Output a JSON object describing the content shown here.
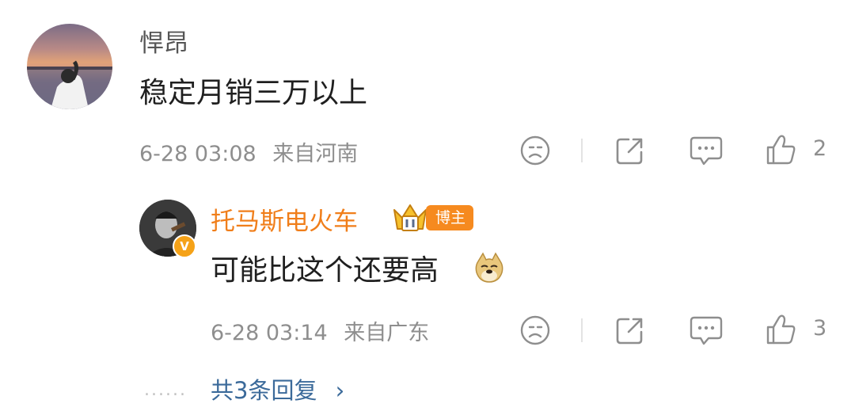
{
  "comment": {
    "username": "悍昂",
    "text": "稳定月销三万以上",
    "time": "6-28 03:08",
    "location": "来自河南",
    "like_count": "2"
  },
  "reply": {
    "username": "托马斯电火车",
    "role_badge": "博主",
    "verified_badge": "V",
    "text": "可能比这个还要高",
    "time": "6-28 03:14",
    "location": "来自广东",
    "like_count": "3"
  },
  "more_replies": {
    "dots": "......",
    "label": "共3条回复",
    "chevron": "›"
  },
  "icons": {
    "dislike": "sad-face-icon",
    "share": "share-icon",
    "reply": "comment-icon",
    "like": "thumbs-up-icon",
    "emoji": "doge-emoji-icon",
    "badge": "crown-badge-icon"
  },
  "colors": {
    "reply_username": "#f07e1a",
    "link": "#3b6a9a",
    "badge": "#f68a1f"
  }
}
